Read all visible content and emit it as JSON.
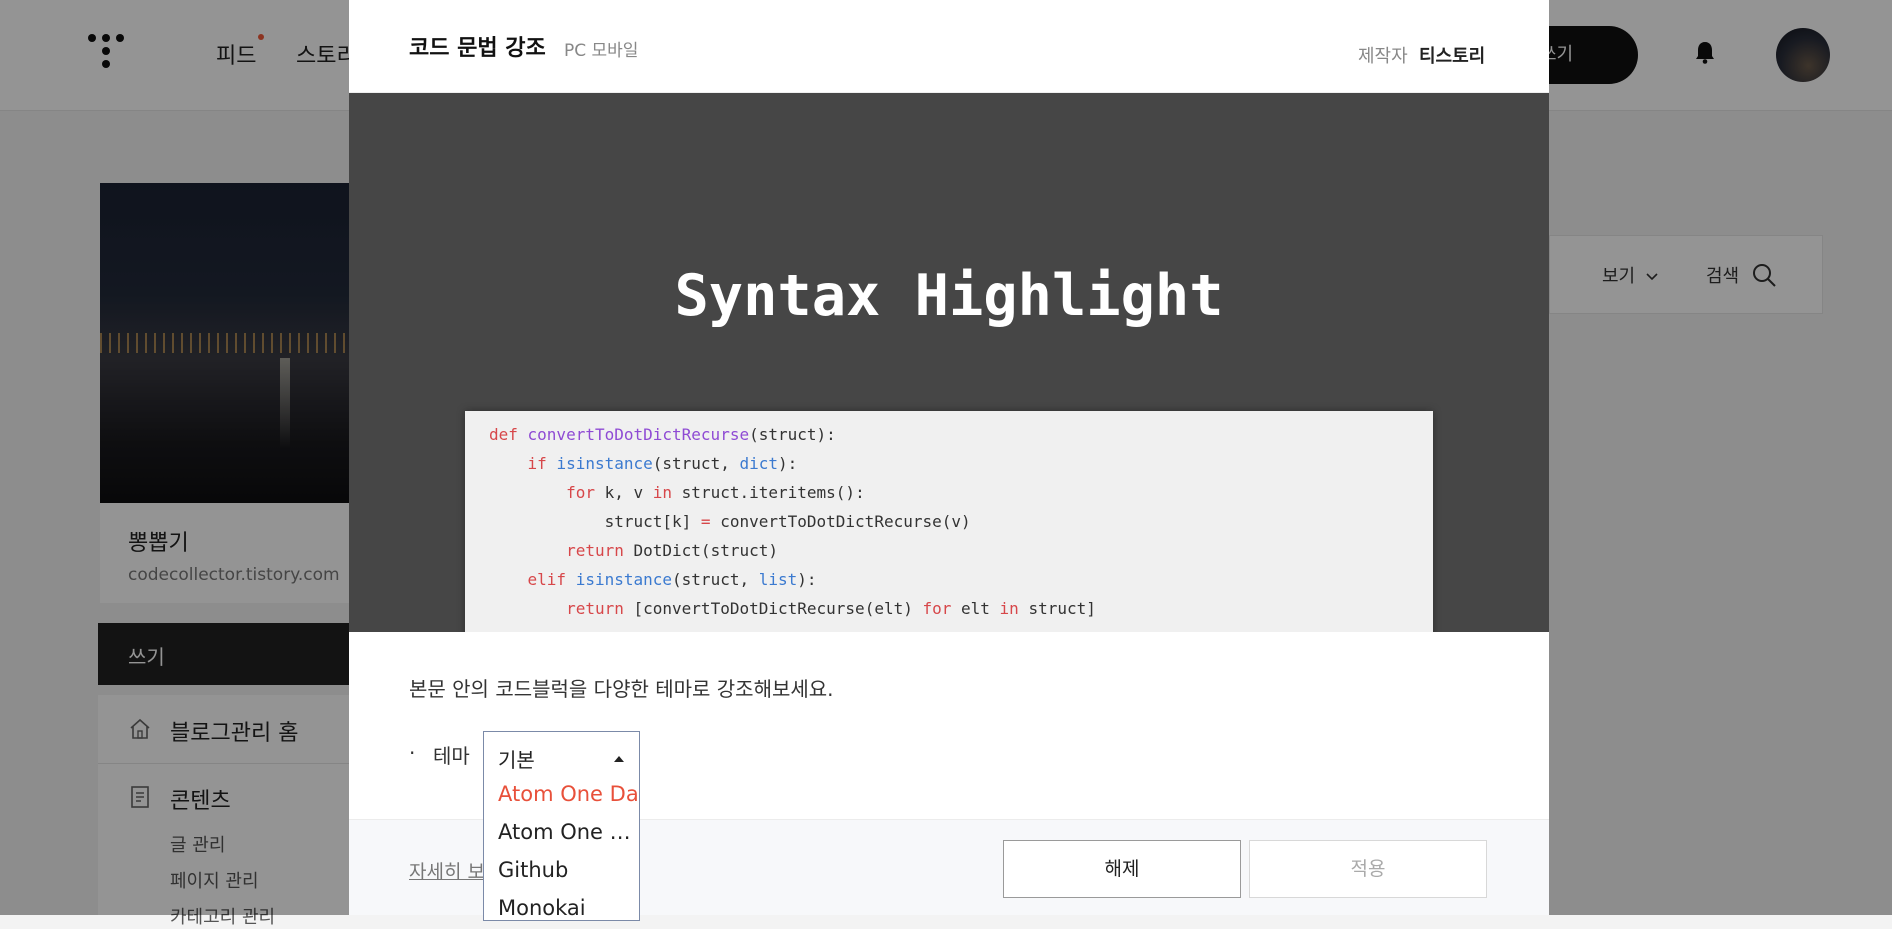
{
  "header": {
    "nav_feed": "피드",
    "nav_story": "스토리",
    "write_button": "쓰기"
  },
  "sidebar": {
    "blog_name": "뽕뽑기",
    "blog_url": "codecollector.tistory.com",
    "write_label": "쓰기",
    "home_label": "블로그관리 홈",
    "contents_label": "콘텐츠",
    "contents_items": [
      "글 관리",
      "페이지 관리",
      "카테고리 관리"
    ]
  },
  "search_panel": {
    "view_label": "보기",
    "search_label": "검색"
  },
  "modal": {
    "title": "코드 문법 강조",
    "subtitle": "PC 모바일",
    "maker_label": "제작자",
    "maker_name": "티스토리",
    "preview_title": "Syntax Highlight",
    "description": "본문 안의 코드블럭을 다양한 테마로 강조해보세요.",
    "theme_bullet": "·",
    "theme_label": "테마",
    "more_link": "자세히 보기",
    "release_button": "해제",
    "apply_button": "적용",
    "theme_dropdown": {
      "selected": "기본",
      "options": [
        "Atom One Dark",
        "Atom One Light",
        "Github",
        "Monokai"
      ],
      "highlighted": "Atom One Dark"
    }
  },
  "code_sample": [
    [
      {
        "t": "def ",
        "c": "kw"
      },
      {
        "t": "convertToDotDictRecurse",
        "c": "fn"
      },
      {
        "t": "(struct):",
        "c": ""
      }
    ],
    [
      {
        "t": "    ",
        "c": ""
      },
      {
        "t": "if ",
        "c": "kw"
      },
      {
        "t": "isinstance",
        "c": "bi"
      },
      {
        "t": "(struct, ",
        "c": ""
      },
      {
        "t": "dict",
        "c": "bi"
      },
      {
        "t": "):",
        "c": ""
      }
    ],
    [
      {
        "t": "        ",
        "c": ""
      },
      {
        "t": "for ",
        "c": "kw"
      },
      {
        "t": "k, v ",
        "c": ""
      },
      {
        "t": "in ",
        "c": "kw"
      },
      {
        "t": "struct.iteritems():",
        "c": ""
      }
    ],
    [
      {
        "t": "            struct[k] ",
        "c": ""
      },
      {
        "t": "= ",
        "c": "kw"
      },
      {
        "t": "convertToDotDictRecurse(v)",
        "c": ""
      }
    ],
    [
      {
        "t": "        ",
        "c": ""
      },
      {
        "t": "return ",
        "c": "kw"
      },
      {
        "t": "DotDict(struct)",
        "c": ""
      }
    ],
    [
      {
        "t": "    ",
        "c": ""
      },
      {
        "t": "elif ",
        "c": "kw"
      },
      {
        "t": "isinstance",
        "c": "bi"
      },
      {
        "t": "(struct, ",
        "c": ""
      },
      {
        "t": "list",
        "c": "bi"
      },
      {
        "t": "):",
        "c": ""
      }
    ],
    [
      {
        "t": "        ",
        "c": ""
      },
      {
        "t": "return ",
        "c": "kw"
      },
      {
        "t": "[convertToDotDictRecurse(elt) ",
        "c": ""
      },
      {
        "t": "for ",
        "c": "kw"
      },
      {
        "t": "elt ",
        "c": ""
      },
      {
        "t": "in ",
        "c": "kw"
      },
      {
        "t": "struct]",
        "c": ""
      }
    ]
  ],
  "colors": {
    "accent_orange": "#e8503a",
    "keyword": "#d7474a",
    "function": "#8f4bd4",
    "builtin": "#3b7ad0",
    "preview_bg": "#464646"
  }
}
